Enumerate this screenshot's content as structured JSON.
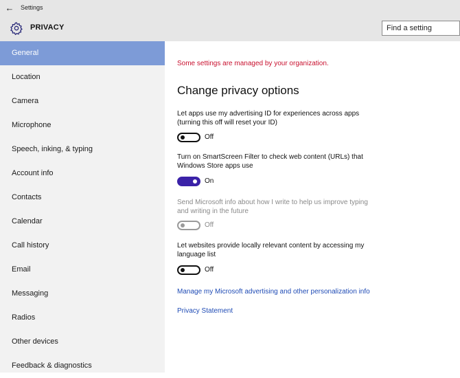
{
  "titlebar": {
    "back_glyph": "←",
    "app_title": "Settings"
  },
  "header": {
    "icon": "gear-icon",
    "page_title": "PRIVACY"
  },
  "search": {
    "placeholder": "Find a setting"
  },
  "sidebar": {
    "items": [
      {
        "label": "General",
        "selected": true
      },
      {
        "label": "Location"
      },
      {
        "label": "Camera"
      },
      {
        "label": "Microphone"
      },
      {
        "label": "Speech, inking, & typing"
      },
      {
        "label": "Account info"
      },
      {
        "label": "Contacts"
      },
      {
        "label": "Calendar"
      },
      {
        "label": "Call history"
      },
      {
        "label": "Email"
      },
      {
        "label": "Messaging"
      },
      {
        "label": "Radios"
      },
      {
        "label": "Other devices"
      },
      {
        "label": "Feedback & diagnostics"
      }
    ]
  },
  "main": {
    "org_note": "Some settings are managed by your organization.",
    "section_title": "Change privacy options",
    "settings": [
      {
        "label_line1": "Let apps use my advertising ID for experiences across apps",
        "label_line2": "(turning this off will reset your ID)",
        "state": "Off",
        "enabled": true
      },
      {
        "label_line1": "Turn on SmartScreen Filter to check web content (URLs) that",
        "label_line2": "Windows Store apps use",
        "state": "On",
        "enabled": true
      },
      {
        "label_line1": "Send Microsoft info about how I write to help us improve typing",
        "label_line2": "and writing in the future",
        "state": "Off",
        "enabled": false
      },
      {
        "label_line1": "Let websites provide locally relevant content by accessing my",
        "label_line2": "language list",
        "state": "Off",
        "enabled": true
      }
    ],
    "links": {
      "advertising": "Manage my Microsoft advertising and other personalization info",
      "privacy_statement": "Privacy Statement"
    }
  },
  "colors": {
    "accent": "#3b22a8",
    "selected_nav": "#7d9bd7",
    "warning": "#c8102e",
    "link": "#1f4bb5"
  }
}
